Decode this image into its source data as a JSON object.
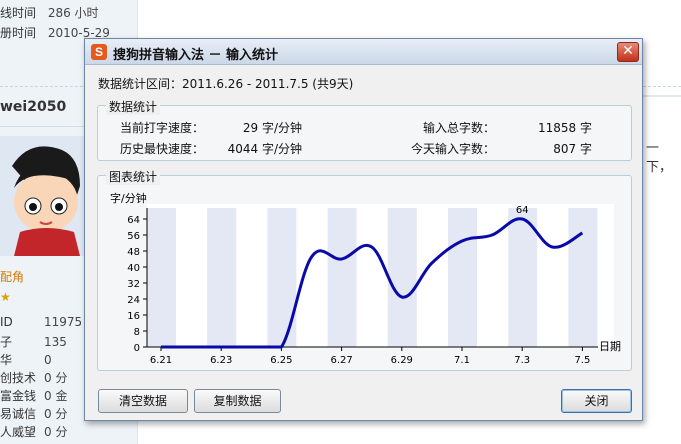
{
  "background": {
    "info_rows": [
      {
        "key": "线时间",
        "value": "286 小时"
      },
      {
        "key": "册时间",
        "value": "2010-5-29"
      }
    ],
    "username": "wei2050",
    "role": "配角",
    "stats": [
      {
        "key": "ID",
        "value": "11975"
      },
      {
        "key": "子",
        "value": "135"
      },
      {
        "key": "华",
        "value": "0"
      },
      {
        "key": "创技术",
        "value": "0 分"
      },
      {
        "key": "富金钱",
        "value": "0 金"
      },
      {
        "key": "易诚信",
        "value": "0 分"
      },
      {
        "key": "人威望",
        "value": "0 分"
      }
    ],
    "right_text": "一下，"
  },
  "dialog": {
    "title": "搜狗拼音输入法 － 输入统计",
    "icon_letter": "S",
    "close_glyph": "✕",
    "range": "数据统计区间：2011.6.26 - 2011.7.5 (共9天)",
    "stats_group_title": "数据统计",
    "current_speed_label": "当前打字速度：",
    "current_speed_value": "29 字/分钟",
    "max_speed_label": "历史最快速度：",
    "max_speed_value": "4044 字/分钟",
    "total_chars_label": "输入总字数：",
    "total_chars_value": "11858 字",
    "today_chars_label": "今天输入字数：",
    "today_chars_value": "807 字",
    "chart_group_title": "图表统计",
    "buttons": {
      "clear": "清空数据",
      "copy": "复制数据",
      "close": "关闭"
    }
  },
  "chart_data": {
    "type": "line",
    "ylabel": "字/分钟",
    "xlabel": "日期",
    "x_tick_labels": [
      "6.21",
      "6.23",
      "6.25",
      "6.27",
      "6.29",
      "7.1",
      "7.3",
      "7.5"
    ],
    "y_ticks": [
      0,
      8,
      16,
      24,
      32,
      40,
      48,
      56,
      64
    ],
    "ylim": [
      0,
      64
    ],
    "xlim": [
      "6.21",
      "7.5"
    ],
    "annotation": "64",
    "series": [
      {
        "color": "#0a0aa8",
        "x": [
          "6.21",
          "6.22",
          "6.23",
          "6.24",
          "6.25",
          "6.26",
          "6.27",
          "6.28",
          "6.29",
          "6.30",
          "7.1",
          "7.2",
          "7.3",
          "7.4",
          "7.5"
        ],
        "y": [
          0,
          0,
          0,
          0,
          0,
          45,
          44,
          50,
          25,
          42,
          53,
          56,
          64,
          50,
          57
        ]
      }
    ],
    "band_color": "#e4e8f4",
    "grid": false
  }
}
